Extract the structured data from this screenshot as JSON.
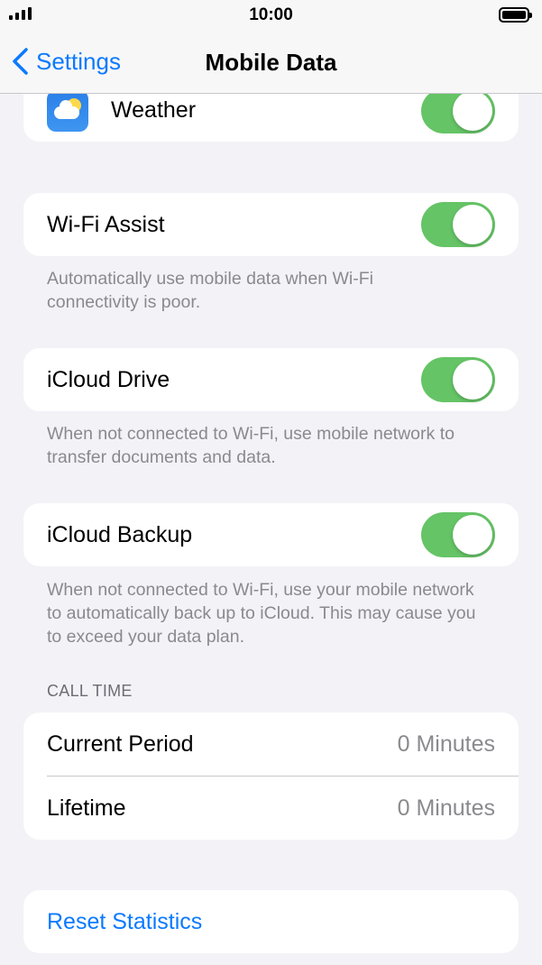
{
  "status_bar": {
    "time": "10:00"
  },
  "nav": {
    "back_label": "Settings",
    "title": "Mobile Data"
  },
  "apps": [
    {
      "label": "Weather",
      "icon": "weather-icon",
      "enabled": true
    }
  ],
  "wifi_assist": {
    "label": "Wi-Fi Assist",
    "enabled": true,
    "footnote": "Automatically use mobile data when Wi-Fi connectivity is poor."
  },
  "icloud_drive": {
    "label": "iCloud Drive",
    "enabled": true,
    "footnote": "When not connected to Wi-Fi, use mobile network to transfer documents and data."
  },
  "icloud_backup": {
    "label": "iCloud Backup",
    "enabled": true,
    "footnote": "When not connected to Wi-Fi, use your mobile network to automatically back up to iCloud. This may cause you to exceed your data plan."
  },
  "call_time": {
    "header": "CALL TIME",
    "rows": [
      {
        "label": "Current Period",
        "value": "0 Minutes"
      },
      {
        "label": "Lifetime",
        "value": "0 Minutes"
      }
    ]
  },
  "reset_label": "Reset Statistics",
  "colors": {
    "accent": "#0a7aff",
    "toggle_on": "#65c466",
    "background": "#f2f2f7"
  }
}
